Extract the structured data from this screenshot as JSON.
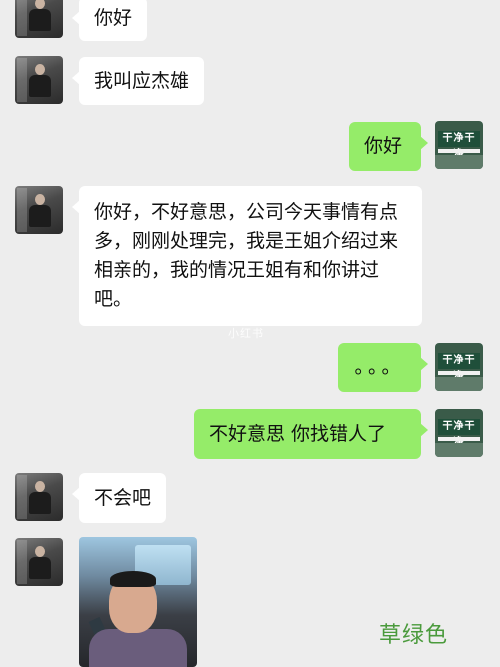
{
  "chat": {
    "messages": [
      {
        "side": "left",
        "text": "你好"
      },
      {
        "side": "left",
        "text": "我叫应杰雄"
      },
      {
        "side": "right",
        "text": "你好"
      },
      {
        "side": "left",
        "text": "你好，不好意思，公司今天事情有点多，刚刚处理完，我是王姐介绍过来相亲的，我的情况王姐有和你讲过吧。"
      },
      {
        "side": "right",
        "text": "。。。"
      },
      {
        "side": "right",
        "text": "不好意思 你找错人了"
      },
      {
        "side": "left",
        "text": "不会吧"
      },
      {
        "side": "left",
        "type": "image"
      }
    ],
    "right_avatar_sign": "干净干净"
  },
  "watermarks": {
    "center": "小红书",
    "corner": "草绿色"
  }
}
